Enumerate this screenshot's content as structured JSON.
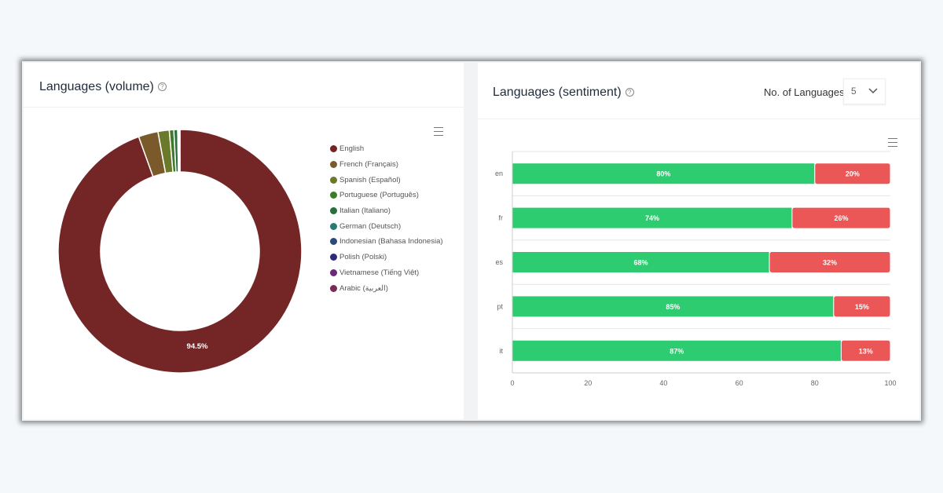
{
  "volume": {
    "title": "Languages (volume)",
    "help_icon": "question-circle-icon",
    "menu_icon": "hamburger-menu-icon"
  },
  "sentiment": {
    "title": "Languages (sentiment)",
    "help_icon": "question-circle-icon",
    "menu_icon": "hamburger-menu-icon",
    "count_label": "No. of Languages",
    "count_value": "5"
  },
  "chart_data": [
    {
      "type": "pie",
      "donut": true,
      "legend_position": "right",
      "labels": [
        "English",
        "French (Français)",
        "Spanish (Español)",
        "Portuguese (Português)",
        "Italian (Italiano)",
        "German (Deutsch)",
        "Indonesian (Bahasa Indonesia)",
        "Polish (Polski)",
        "Vietnamese (Tiếng Việt)",
        "Arabic (العربية)"
      ],
      "values": [
        94.5,
        2.6,
        1.5,
        0.6,
        0.5,
        0.1,
        0.1,
        0.05,
        0.03,
        0.02
      ],
      "colors": [
        "#742626",
        "#7a5a2a",
        "#6b7a2a",
        "#3f7a2a",
        "#2a6e3f",
        "#2a7a72",
        "#2a4a7a",
        "#2e2a7a",
        "#6a2a7a",
        "#7a2a55"
      ],
      "data_labels": [
        "94.5%"
      ]
    },
    {
      "type": "bar",
      "orientation": "horizontal",
      "stacked": true,
      "categories": [
        "en",
        "fr",
        "es",
        "pt",
        "it"
      ],
      "series": [
        {
          "values": [
            80,
            74,
            68,
            85,
            87
          ],
          "color": "#2ecc71"
        },
        {
          "values": [
            20,
            26,
            32,
            15,
            13
          ],
          "color": "#eb5757"
        }
      ],
      "xlim": [
        0,
        100
      ],
      "xticks": [
        0,
        20,
        40,
        60,
        80,
        100
      ],
      "grid": true
    }
  ]
}
